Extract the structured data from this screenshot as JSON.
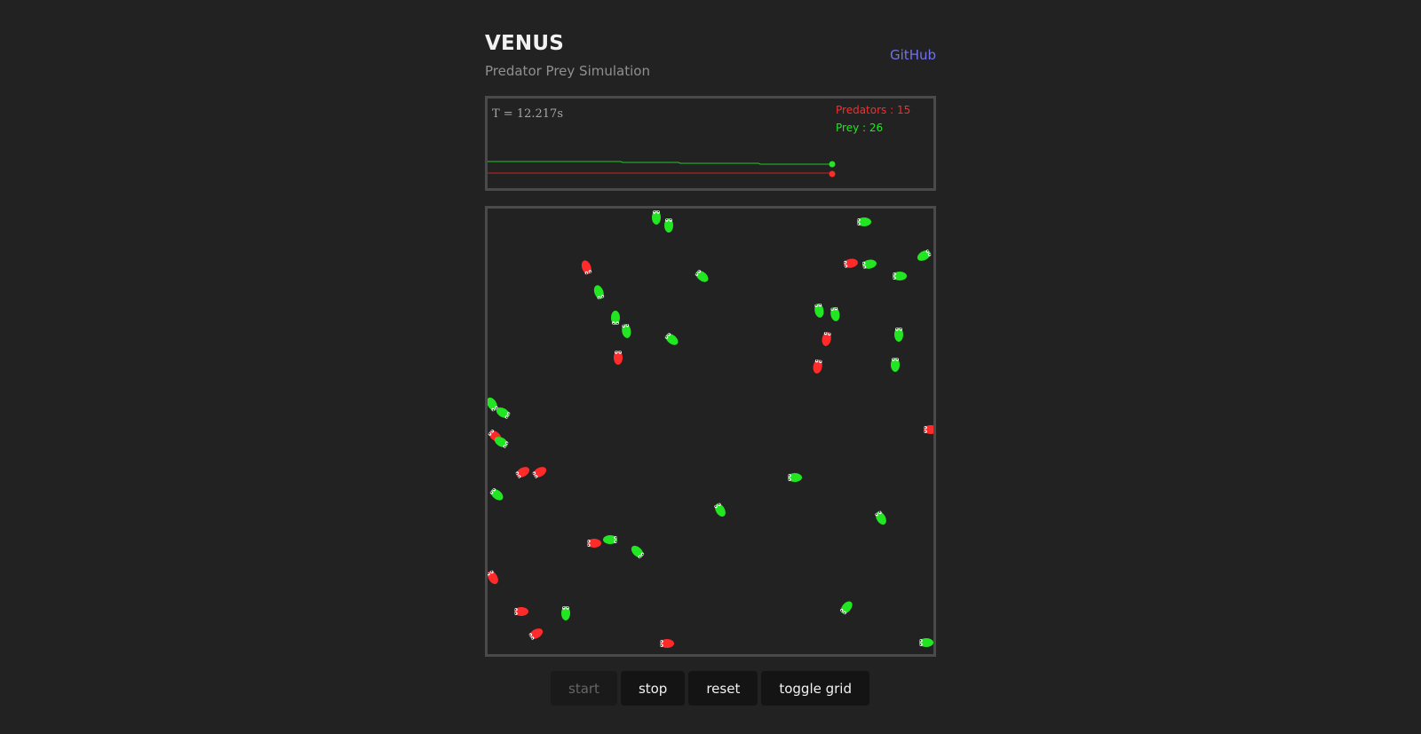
{
  "header": {
    "title": "VENUS",
    "subtitle": "Predator Prey Simulation",
    "github_label": "GitHub"
  },
  "stats": {
    "time_label": "T = 12.217s",
    "predators_label": "Predators : 15",
    "prey_label": "Prey : 26"
  },
  "colors": {
    "background": "#222222",
    "predator": "#ff2a2a",
    "prey": "#22e622",
    "link": "#7272ee"
  },
  "controls": {
    "start_label": "start",
    "stop_label": "stop",
    "reset_label": "reset",
    "toggle_grid_label": "toggle grid"
  }
}
